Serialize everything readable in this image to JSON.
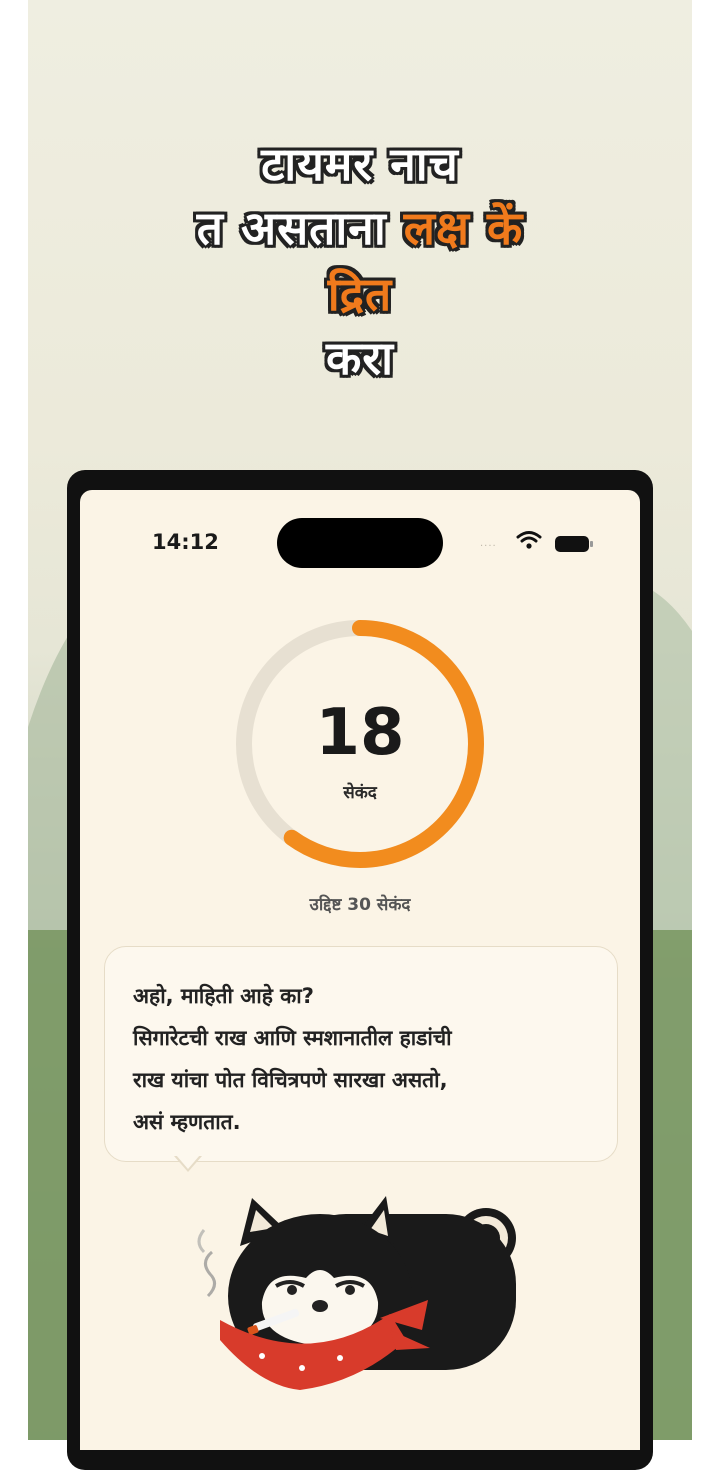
{
  "headline": {
    "line1": "टायमर नाच",
    "line2_start": "त असताना ",
    "line2_accent": "लक्ष कें",
    "line3_accent": "द्रित",
    "line4": "करा"
  },
  "status_bar": {
    "time": "14:12"
  },
  "timer": {
    "value": "18",
    "unit": "सेकंद",
    "goal_label": "उद्दिष्ट 30 सेकंद",
    "progress_fraction": 0.6
  },
  "message": {
    "lines": [
      "अहो, माहिती आहे का?",
      "सिगारेटची राख आणि स्मशानातील हाडांची",
      "राख यांचा पोत विचित्रपणे सारखा असतो,",
      "असं म्हणतात."
    ]
  },
  "colors": {
    "accent": "#f07a1c",
    "ring_track": "#e7e0d2",
    "screen_bg": "#fbf4e6"
  }
}
